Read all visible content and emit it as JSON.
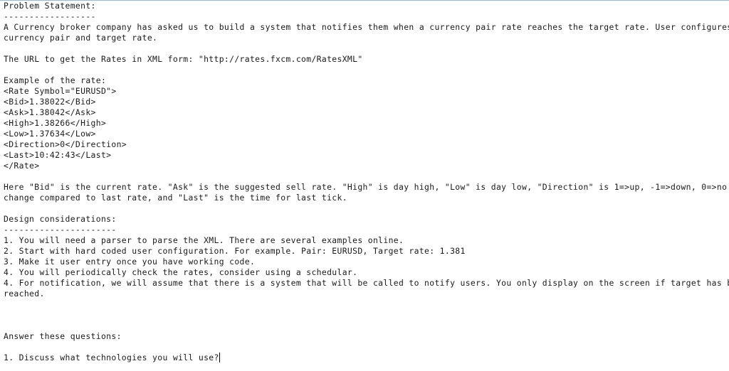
{
  "document": {
    "heading": "Problem Statement:",
    "heading_rule": "------------------",
    "intro_line_1": "A Currency broker company has asked us to build a system that notifies them when a currency pair rate reaches the target rate. User configures the",
    "intro_line_2": "currency pair and target rate.",
    "url_line": "The URL to get the Rates in XML form: \"http://rates.fxcm.com/RatesXML\"",
    "example_heading": "Example of the rate:",
    "xml_lines": [
      "<Rate Symbol=\"EURUSD\">",
      "<Bid>1.38022</Bid>",
      "<Ask>1.38042</Ask>",
      "<High>1.38266</High>",
      "<Low>1.37634</Low>",
      "<Direction>0</Direction>",
      "<Last>10:42:43</Last>",
      "</Rate>"
    ],
    "explain_line_1": "Here \"Bid\" is the current rate. \"Ask\" is the suggested sell rate. \"High\" is day high, \"Low\" is day low, \"Direction\" is 1=>up, -1=>down, 0=>no",
    "explain_line_2": "change compared to last rate, and \"Last\" is the time for last tick.",
    "design_heading": "Design considerations:",
    "design_rule": "----------------------",
    "design_items": [
      "1. You will need a parser to parse the XML. There are several examples online.",
      "2. Start with hard coded user configuration. For example. Pair: EURUSD, Target rate: 1.381",
      "3. Make it user entry once you have working code.",
      "4. You will periodically check the rates, consider using a schedular.",
      "4. For notification, we will assume that there is a system that will be called to notify users. You only display on the screen if target has been"
    ],
    "design_item_5_cont": "reached.",
    "questions_heading": "Answer these questions:",
    "question_1": "1. Discuss what technologies you will use?"
  }
}
